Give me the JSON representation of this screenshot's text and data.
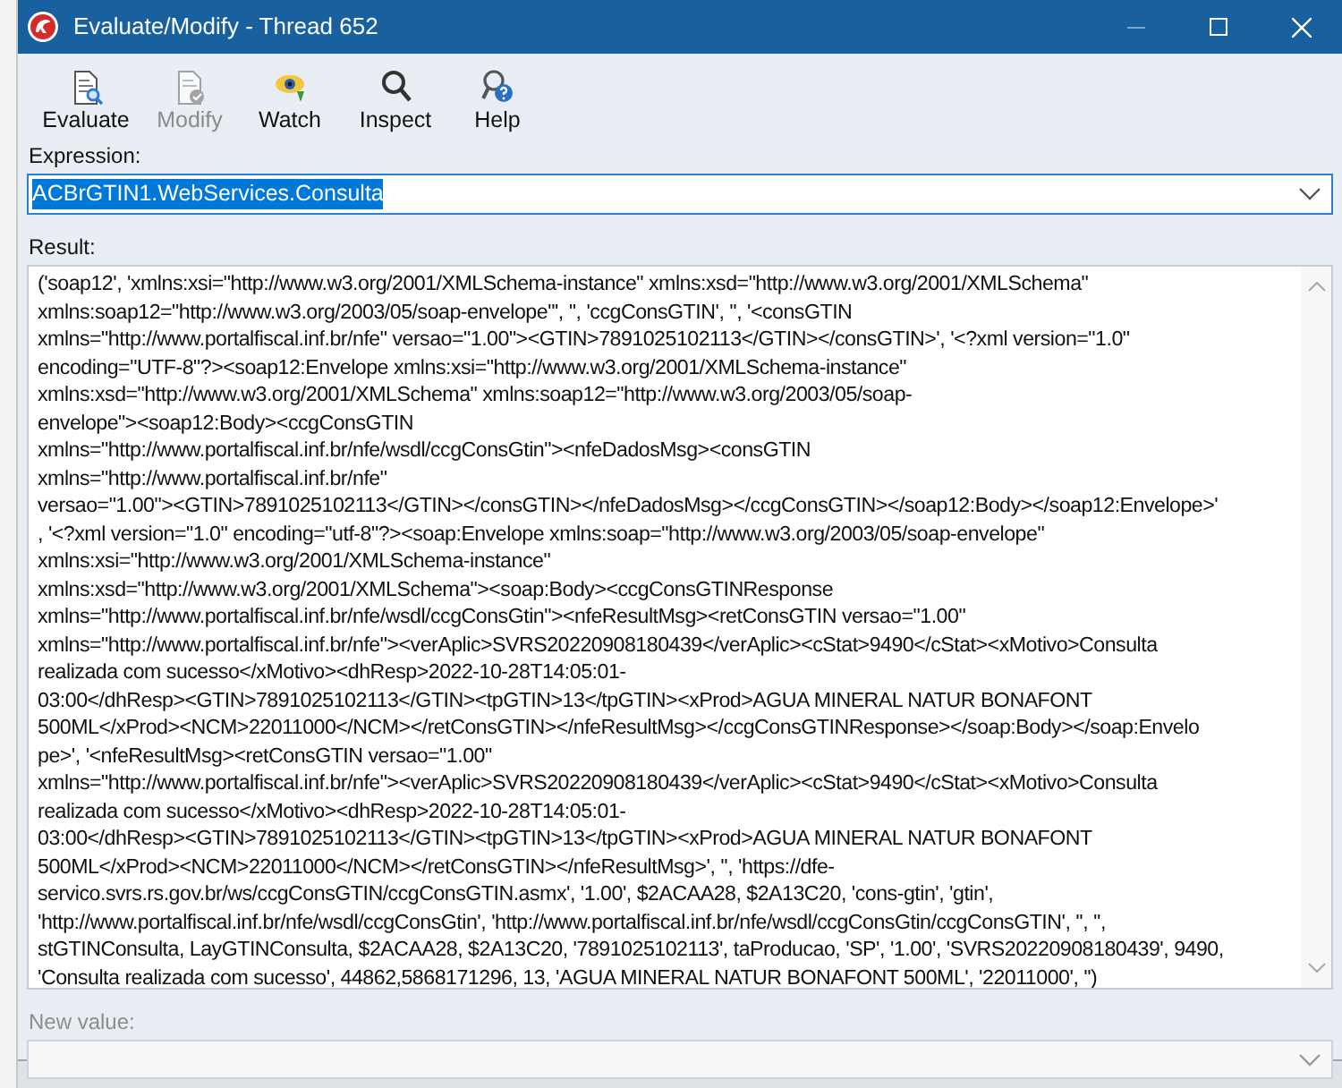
{
  "window": {
    "title": "Evaluate/Modify - Thread 652"
  },
  "toolbar": [
    {
      "kind": "evaluate",
      "label": "Evaluate",
      "disabled": false
    },
    {
      "kind": "modify",
      "label": "Modify",
      "disabled": true
    },
    {
      "kind": "watch",
      "label": "Watch",
      "disabled": false
    },
    {
      "kind": "inspect",
      "label": "Inspect",
      "disabled": false
    },
    {
      "kind": "help",
      "label": "Help",
      "disabled": false
    }
  ],
  "expression": {
    "label": "Expression:",
    "value": "ACBrGTIN1.WebServices.Consulta"
  },
  "result": {
    "label": "Result:",
    "lines": [
      "('soap12', 'xmlns:xsi=\"http://www.w3.org/2001/XMLSchema-instance\" xmlns:xsd=\"http://www.w3.org/2001/XMLSchema\"",
      "xmlns:soap12=\"http://www.w3.org/2003/05/soap-envelope\"', '', 'ccgConsGTIN', '', '<consGTIN",
      "xmlns=\"http://www.portalfiscal.inf.br/nfe\" versao=\"1.00\"><GTIN>7891025102113</GTIN></consGTIN>', '<?xml version=\"1.0\"",
      "encoding=\"UTF-8\"?><soap12:Envelope xmlns:xsi=\"http://www.w3.org/2001/XMLSchema-instance\"",
      "xmlns:xsd=\"http://www.w3.org/2001/XMLSchema\" xmlns:soap12=\"http://www.w3.org/2003/05/soap-",
      "envelope\"><soap12:Body><ccgConsGTIN",
      "xmlns=\"http://www.portalfiscal.inf.br/nfe/wsdl/ccgConsGtin\"><nfeDadosMsg><consGTIN",
      "xmlns=\"http://www.portalfiscal.inf.br/nfe\"",
      "versao=\"1.00\"><GTIN>7891025102113</GTIN></consGTIN></nfeDadosMsg></ccgConsGTIN></soap12:Body></soap12:Envelope>'",
      ", '<?xml version=\"1.0\" encoding=\"utf-8\"?><soap:Envelope xmlns:soap=\"http://www.w3.org/2003/05/soap-envelope\"",
      "xmlns:xsi=\"http://www.w3.org/2001/XMLSchema-instance\"",
      "xmlns:xsd=\"http://www.w3.org/2001/XMLSchema\"><soap:Body><ccgConsGTINResponse",
      "xmlns=\"http://www.portalfiscal.inf.br/nfe/wsdl/ccgConsGtin\"><nfeResultMsg><retConsGTIN versao=\"1.00\"",
      "xmlns=\"http://www.portalfiscal.inf.br/nfe\"><verAplic>SVRS20220908180439</verAplic><cStat>9490</cStat><xMotivo>Consulta",
      "realizada com sucesso</xMotivo><dhResp>2022-10-28T14:05:01-",
      "03:00</dhResp><GTIN>7891025102113</GTIN><tpGTIN>13</tpGTIN><xProd>AGUA MINERAL NATUR BONAFONT",
      "500ML</xProd><NCM>22011000</NCM></retConsGTIN></nfeResultMsg></ccgConsGTINResponse></soap:Body></soap:Envelo",
      "pe>', '<nfeResultMsg><retConsGTIN versao=\"1.00\"",
      "xmlns=\"http://www.portalfiscal.inf.br/nfe\"><verAplic>SVRS20220908180439</verAplic><cStat>9490</cStat><xMotivo>Consulta",
      "realizada com sucesso</xMotivo><dhResp>2022-10-28T14:05:01-",
      "03:00</dhResp><GTIN>7891025102113</GTIN><tpGTIN>13</tpGTIN><xProd>AGUA MINERAL NATUR BONAFONT",
      "500ML</xProd><NCM>22011000</NCM></retConsGTIN></nfeResultMsg>', '', 'https://dfe-",
      "servico.svrs.rs.gov.br/ws/ccgConsGTIN/ccgConsGTIN.asmx', '1.00', $2ACAA28, $2A13C20, 'cons-gtin', 'gtin',",
      "'http://www.portalfiscal.inf.br/nfe/wsdl/ccgConsGtin', 'http://www.portalfiscal.inf.br/nfe/wsdl/ccgConsGtin/ccgConsGTIN', '', '',",
      "stGTINConsulta, LayGTINConsulta, $2ACAA28, $2A13C20, '7891025102113', taProducao, 'SP', '1.00', 'SVRS20220908180439', 9490,",
      "'Consulta realizada com sucesso', 44862,5868171296, 13, 'AGUA MINERAL NATUR BONAFONT 500ML', '22011000', '')"
    ]
  },
  "new_value": {
    "label": "New value:",
    "disabled": true
  }
}
